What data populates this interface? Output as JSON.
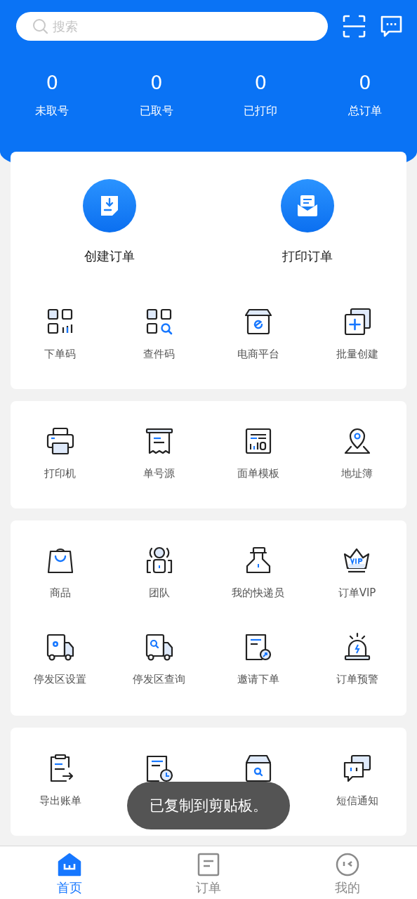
{
  "search": {
    "placeholder": "搜索"
  },
  "stats": [
    {
      "value": "0",
      "label": "未取号"
    },
    {
      "value": "0",
      "label": "已取号"
    },
    {
      "value": "0",
      "label": "已打印"
    },
    {
      "value": "0",
      "label": "总订单"
    }
  ],
  "actions": [
    {
      "label": "创建订单"
    },
    {
      "label": "打印订单"
    }
  ],
  "sections": [
    {
      "items": [
        {
          "label": "下单码"
        },
        {
          "label": "查件码"
        },
        {
          "label": "电商平台"
        },
        {
          "label": "批量创建"
        }
      ]
    },
    {
      "items": [
        {
          "label": "打印机"
        },
        {
          "label": "单号源"
        },
        {
          "label": "面单模板"
        },
        {
          "label": "地址簿"
        }
      ]
    },
    {
      "items": [
        {
          "label": "商品"
        },
        {
          "label": "团队"
        },
        {
          "label": "我的快递员"
        },
        {
          "label": "订单VIP"
        },
        {
          "label": "停发区设置"
        },
        {
          "label": "停发区查询"
        },
        {
          "label": "邀请下单"
        },
        {
          "label": "订单预警"
        }
      ]
    },
    {
      "items": [
        {
          "kind": "labeled",
          "label": "导出账单"
        },
        {
          "kind": "covered"
        },
        {
          "kind": "covered"
        },
        {
          "kind": "labeled",
          "label": "短信通知"
        }
      ]
    }
  ],
  "toast": "已复制到剪贴板。",
  "tabs": [
    {
      "label": "首页",
      "selected": true
    },
    {
      "label": "订单",
      "selected": false
    },
    {
      "label": "我的",
      "selected": false
    }
  ]
}
